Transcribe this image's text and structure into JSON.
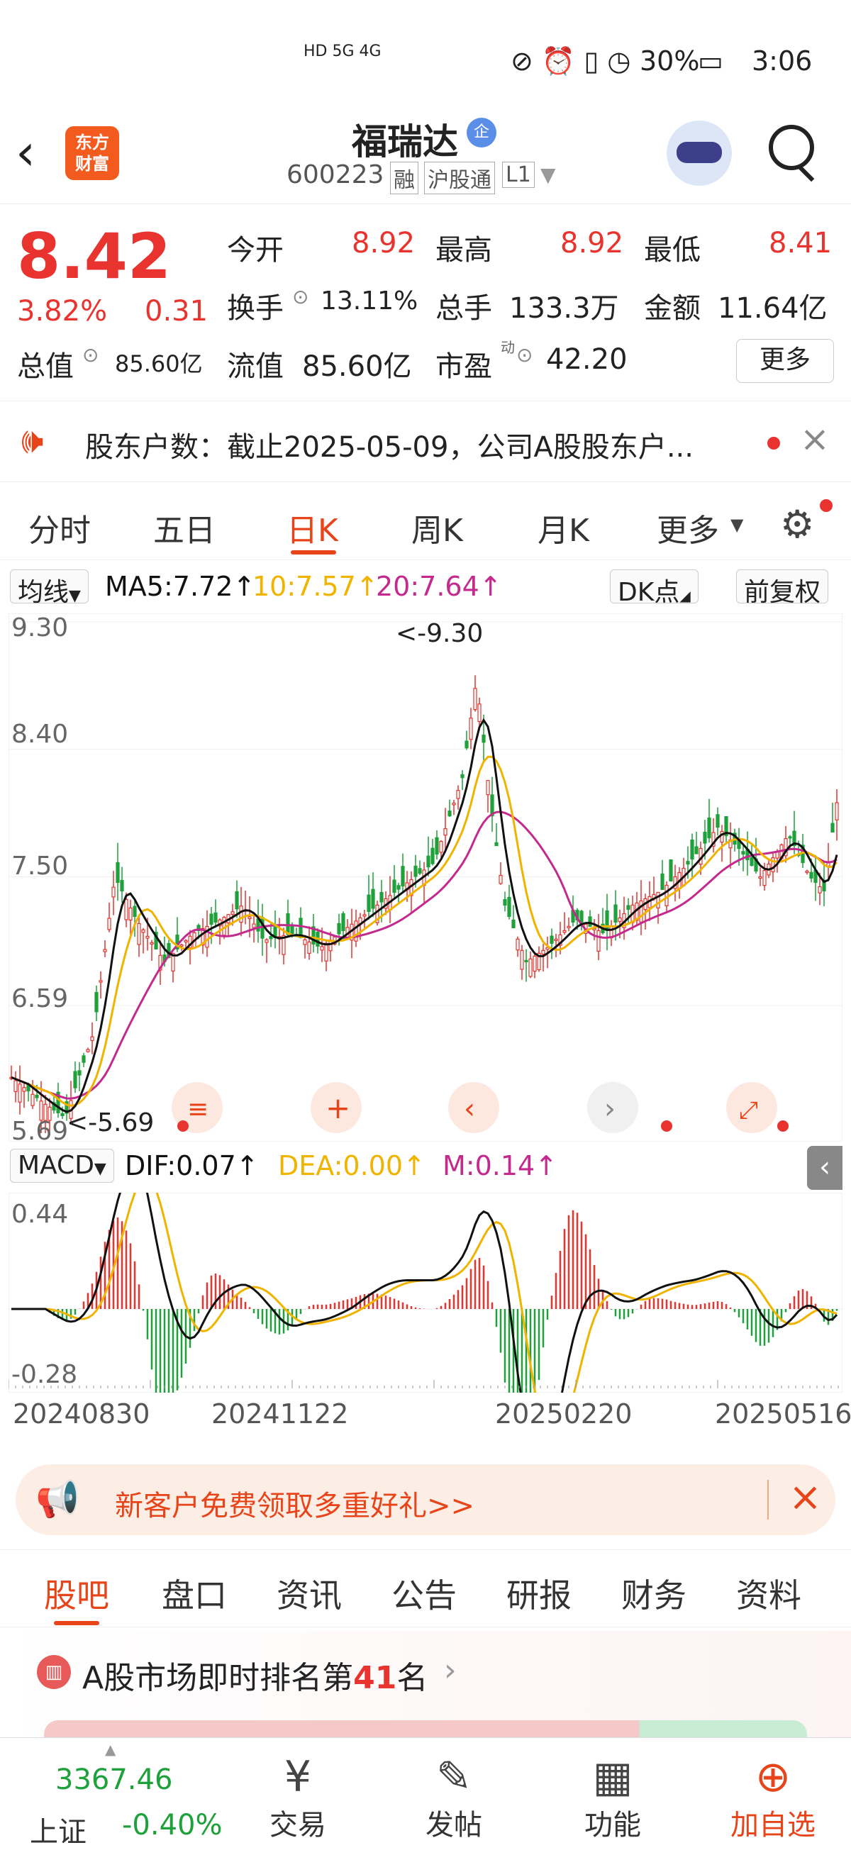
{
  "status_bar": {
    "battery": "30%",
    "time": "3:06",
    "net": "HD 5G 4G"
  },
  "header": {
    "logo_line1": "东方",
    "logo_line2": "财富",
    "title": "福瑞达",
    "badge": "企",
    "code": "600223",
    "tag_margin": "融",
    "tag_connect": "沪股通",
    "tag_level": "L1"
  },
  "quote": {
    "price": "8.42",
    "change_pct": "3.82%",
    "change": "0.31",
    "open_label": "今开",
    "open": "8.92",
    "high_label": "最高",
    "high": "8.92",
    "low_label": "最低",
    "low": "8.41",
    "turnover_label": "换手",
    "turnover": "13.11%",
    "volume_label": "总手",
    "volume": "133.3万",
    "amount_label": "金额",
    "amount": "11.64亿",
    "mktcap_label": "总值",
    "mktcap": "85.60亿",
    "float_label": "流值",
    "float": "85.60亿",
    "pe_label": "市盈",
    "pe_sup": "动",
    "pe": "42.20",
    "more": "更多"
  },
  "notice": {
    "text": "股东户数：截止2025-05-09，公司A股股东户..."
  },
  "chart_tabs": [
    "分时",
    "五日",
    "日K",
    "周K",
    "月K",
    "更多"
  ],
  "active_tab": "日K",
  "ma_bar": {
    "select": "均线",
    "ma5": "MA5:7.72↑",
    "ma10": "10:7.57↑",
    "ma20": "20:7.64↑",
    "dk": "DK点",
    "adjust": "前复权"
  },
  "colors": {
    "up": "#e8332f",
    "down": "#1ea03a",
    "ma5": "#111111",
    "ma10": "#f0b400",
    "ma20": "#c42a8e",
    "accent": "#e8441a"
  },
  "kline": {
    "y_ticks": [
      "9.30",
      "8.40",
      "7.50",
      "6.59",
      "5.69"
    ],
    "max_label": "<-9.30",
    "min_label": "<-5.69"
  },
  "macd_bar": {
    "select": "MACD",
    "dif": "DIF:0.07↑",
    "dea": "DEA:0.00↑",
    "m": "M:0.14↑"
  },
  "macd": {
    "y_top": "0.44",
    "y_bottom": "-0.28"
  },
  "dates": [
    "20240830",
    "20241122",
    "20250220",
    "20250516"
  ],
  "promo": {
    "text": "新客户免费领取多重好礼>>"
  },
  "sub_tabs": [
    "股吧",
    "盘口",
    "资讯",
    "公告",
    "研报",
    "财务",
    "资料"
  ],
  "rank": {
    "prefix": "A股市场即时排名第",
    "num": "41",
    "suffix": "名"
  },
  "bottom_nav": {
    "index_value": "3367.46",
    "index_name": "上证",
    "index_change": "-0.40%",
    "trade": "交易",
    "post": "发帖",
    "func": "功能",
    "add": "加自选"
  },
  "chart_data": {
    "type": "candlestick",
    "y_range": [
      5.69,
      9.3
    ],
    "x_labels": [
      "20240830",
      "20241122",
      "20250220",
      "20250516"
    ],
    "last_close": 8.42,
    "max": 9.3,
    "min": 5.69
  }
}
